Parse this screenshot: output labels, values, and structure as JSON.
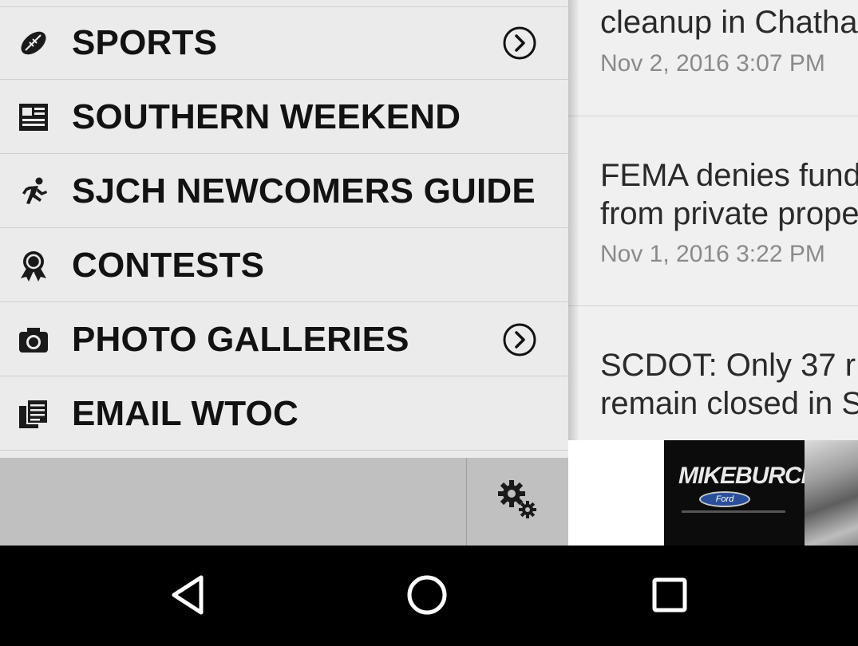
{
  "drawer": {
    "items": [
      {
        "label": "SPORTS",
        "icon": "football-icon",
        "has_chevron": true
      },
      {
        "label": "SOUTHERN WEEKEND",
        "icon": "newspaper-icon",
        "has_chevron": false
      },
      {
        "label": "SJCH NEWCOMERS GUIDE",
        "icon": "running-person-icon",
        "has_chevron": false
      },
      {
        "label": "CONTESTS",
        "icon": "award-ribbon-icon",
        "has_chevron": false
      },
      {
        "label": "PHOTO GALLERIES",
        "icon": "camera-icon",
        "has_chevron": true
      },
      {
        "label": "EMAIL WTOC",
        "icon": "documents-icon",
        "has_chevron": false
      }
    ],
    "footer": {
      "settings_icon": "gears-icon"
    }
  },
  "articles": [
    {
      "headline": "cleanup in Chatha",
      "date": "Nov 2, 2016 3:07 PM"
    },
    {
      "headline_line1": "FEMA denies fund",
      "headline_line2": "from private prope",
      "date": "Nov 1, 2016 3:22 PM"
    },
    {
      "headline_line1": "SCDOT: Only 37 r",
      "headline_line2": "remain closed in S"
    }
  ],
  "ad": {
    "brand_text": "MIKEBURCH",
    "badge_text": "Ford"
  },
  "nav": {
    "back_icon": "back-triangle-icon",
    "home_icon": "home-circle-icon",
    "recents_icon": "recents-square-icon"
  },
  "colors": {
    "drawer_bg": "#ebebeb",
    "footer_bg": "#c0c0c0",
    "content_bg": "#f0f0f0",
    "nav_bg": "#000000"
  }
}
